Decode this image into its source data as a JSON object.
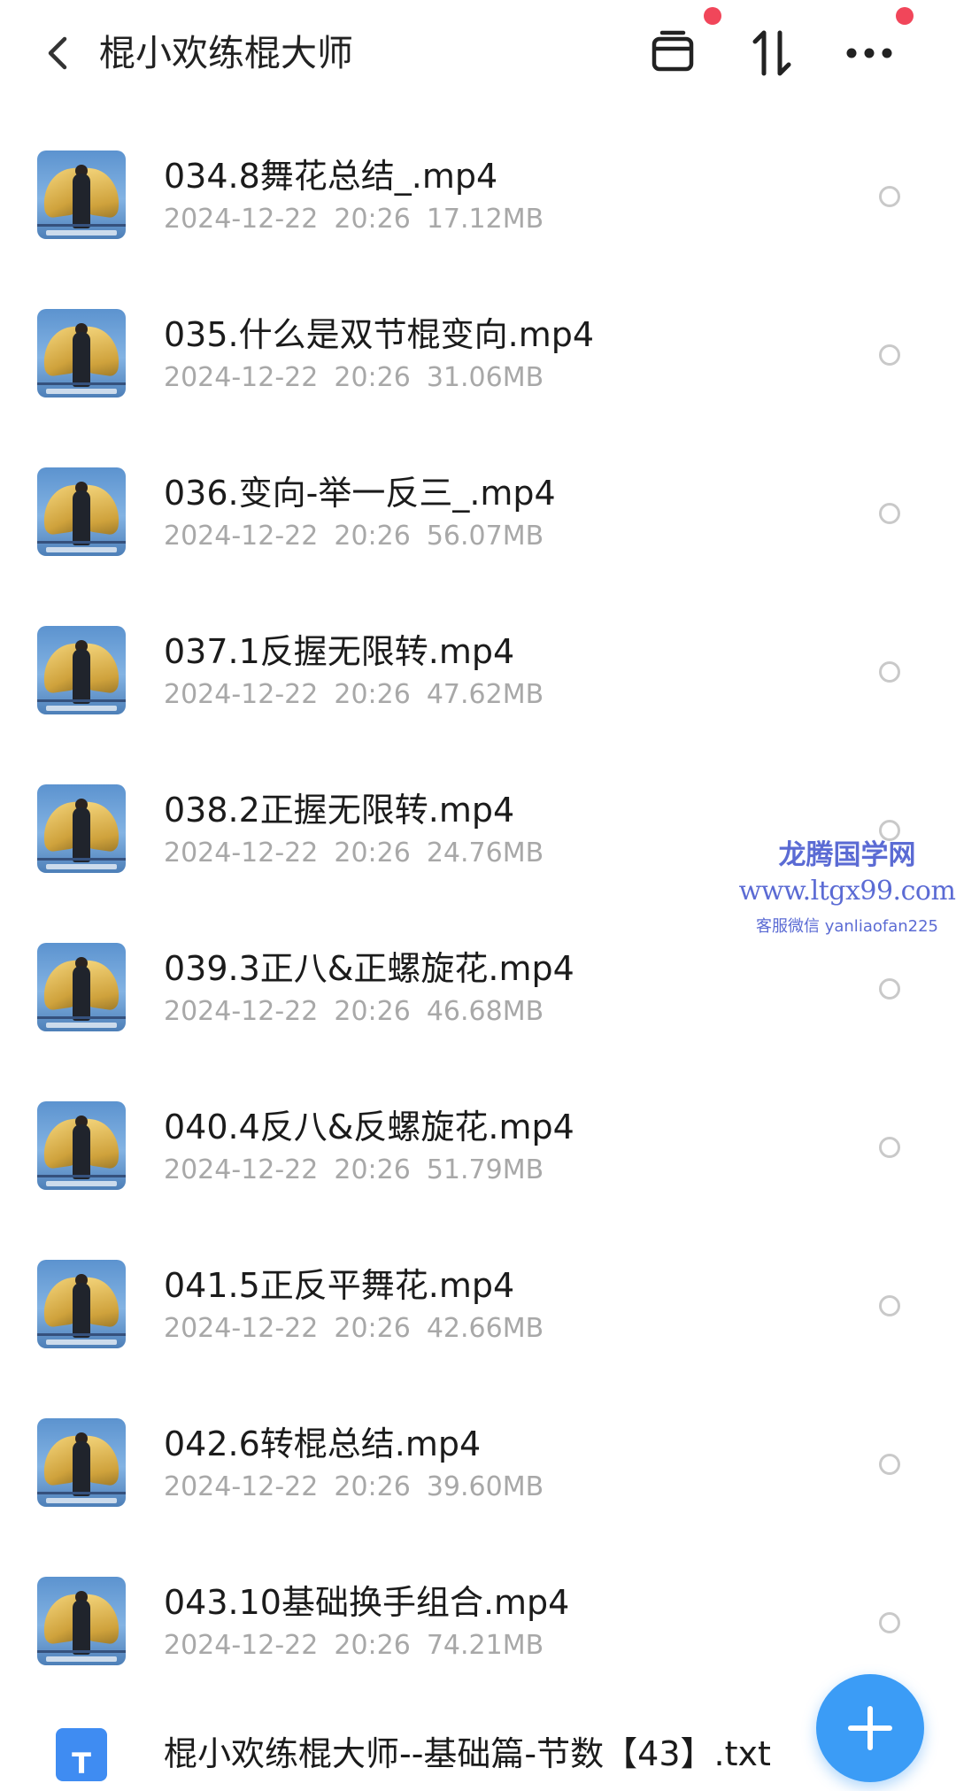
{
  "header": {
    "title": "棍小欢练棍大师",
    "back_icon": "chevron-left-icon",
    "icons": [
      "archive-box-icon",
      "sort-arrows-icon",
      "more-dots-icon"
    ],
    "badge_color": "#f1465a"
  },
  "files": [
    {
      "name": "034.8舞花总结_.mp4",
      "date": "2024-12-22",
      "time": "20:26",
      "size": "17.12MB"
    },
    {
      "name": "035.什么是双节棍变向.mp4",
      "date": "2024-12-22",
      "time": "20:26",
      "size": "31.06MB"
    },
    {
      "name": "036.变向-举一反三_.mp4",
      "date": "2024-12-22",
      "time": "20:26",
      "size": "56.07MB"
    },
    {
      "name": "037.1反握无限转.mp4",
      "date": "2024-12-22",
      "time": "20:26",
      "size": "47.62MB"
    },
    {
      "name": "038.2正握无限转.mp4",
      "date": "2024-12-22",
      "time": "20:26",
      "size": "24.76MB"
    },
    {
      "name": "039.3正八&正螺旋花.mp4",
      "date": "2024-12-22",
      "time": "20:26",
      "size": "46.68MB"
    },
    {
      "name": "040.4反八&反螺旋花.mp4",
      "date": "2024-12-22",
      "time": "20:26",
      "size": "51.79MB"
    },
    {
      "name": "041.5正反平舞花.mp4",
      "date": "2024-12-22",
      "time": "20:26",
      "size": "42.66MB"
    },
    {
      "name": "042.6转棍总结.mp4",
      "date": "2024-12-22",
      "time": "20:26",
      "size": "39.60MB"
    },
    {
      "name": "043.10基础换手组合.mp4",
      "date": "2024-12-22",
      "time": "20:26",
      "size": "74.21MB"
    },
    {
      "name": "棍小欢练棍大师--基础篇-节数【43】.txt",
      "date": "",
      "time": "",
      "size": "",
      "type": "txt"
    }
  ],
  "watermark": {
    "title": "龙腾国学网",
    "url": "www.ltgx99.com",
    "contact": "客服微信 yanliaofan225"
  },
  "fab": {
    "icon": "plus-icon",
    "color": "#3b9cf6"
  }
}
